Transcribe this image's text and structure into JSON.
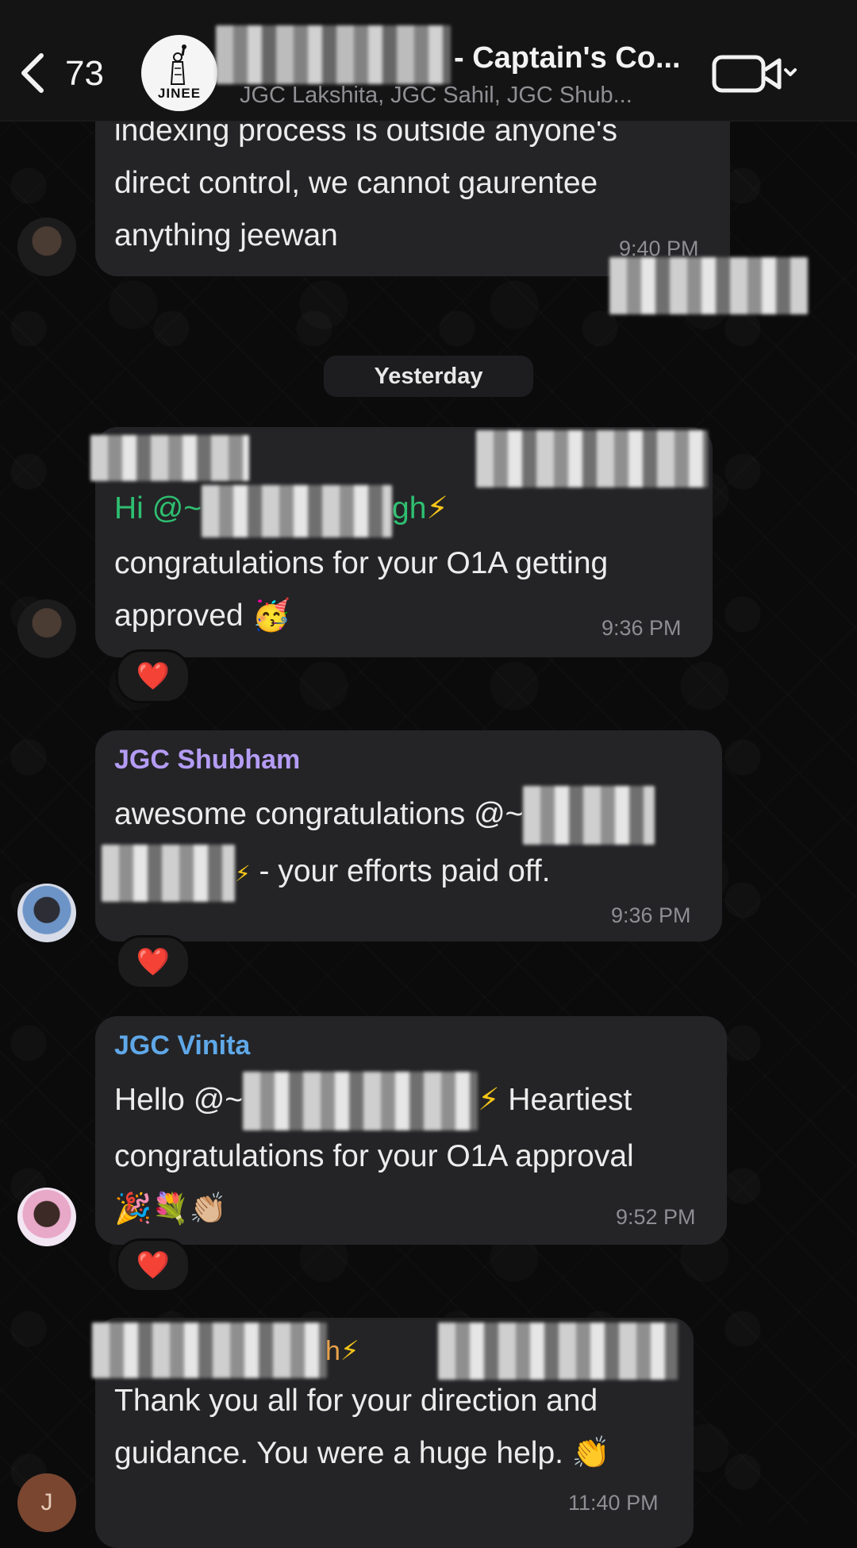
{
  "header": {
    "unread_count": "73",
    "avatar_logo_text": "JINEE",
    "title": "- Captain's Co...",
    "subtitle": "JGC Lakshita, JGC Sahil, JGC Shub..."
  },
  "messages": {
    "m1": {
      "lines": [
        "indexing process is outside anyone's",
        "direct control, we cannot gaurentee",
        "anything jeewan"
      ],
      "time": "9:40 PM"
    },
    "date_divider": "Yesterday",
    "m2": {
      "line1_prefix": "Hi @~",
      "line1_tail": "gh",
      "line1_emoji": "⚡",
      "line2": "congratulations for  your O1A getting",
      "line3": "approved",
      "line3_emoji": "🥳",
      "time": "9:36 PM",
      "reaction": "❤️"
    },
    "m3": {
      "sender": "JGC Shubham",
      "line1": "awesome congratulations @~",
      "line2_emoji": "⚡",
      "line2": " - your efforts paid off.",
      "time": "9:36 PM",
      "reaction": "❤️"
    },
    "m4": {
      "sender": "JGC Vinita",
      "line1_prefix": "Hello @~",
      "line1_emoji": "⚡",
      "line1_suffix": " Heartiest",
      "line2": "congratulations for your O1A approval",
      "line3_emoji": "🎉💐👏🏼",
      "time": "9:52 PM",
      "reaction": "❤️"
    },
    "m5": {
      "sender_tail": "h",
      "sender_emoji": "⚡",
      "line1": "Thank you all for your direction and",
      "line2": "guidance. You were a huge help.",
      "line2_emoji": "👏",
      "time": "11:40 PM",
      "avatar_initial": "J"
    }
  }
}
